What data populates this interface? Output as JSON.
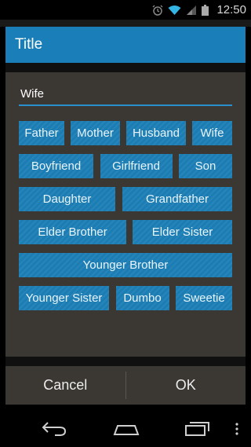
{
  "status_bar": {
    "time": "12:50",
    "icons": [
      "alarm-icon",
      "wifi-icon",
      "signal-icon",
      "battery-icon"
    ]
  },
  "dialog": {
    "title": "Title",
    "input": {
      "value": "Wife",
      "placeholder": ""
    },
    "chip_rows": [
      [
        "Father",
        "Mother",
        "Husband",
        "Wife"
      ],
      [
        "Boyfriend",
        "Girlfriend",
        "Son"
      ],
      [
        "Daughter",
        "Grandfather"
      ],
      [
        "Elder Brother",
        "Elder Sister"
      ],
      [
        "Younger Brother"
      ],
      [
        "Younger Sister",
        "Dumbo",
        "Sweetie"
      ]
    ],
    "cancel_label": "Cancel",
    "ok_label": "OK"
  },
  "nav_bar": {
    "buttons": [
      "back-icon",
      "home-icon",
      "recent-apps-icon",
      "overflow-menu-icon"
    ]
  },
  "colors": {
    "accent": "#1a7fb8",
    "chip": "#1b7db4",
    "dialog_bg": "#3b3834",
    "input_underline": "#2b8fce"
  }
}
